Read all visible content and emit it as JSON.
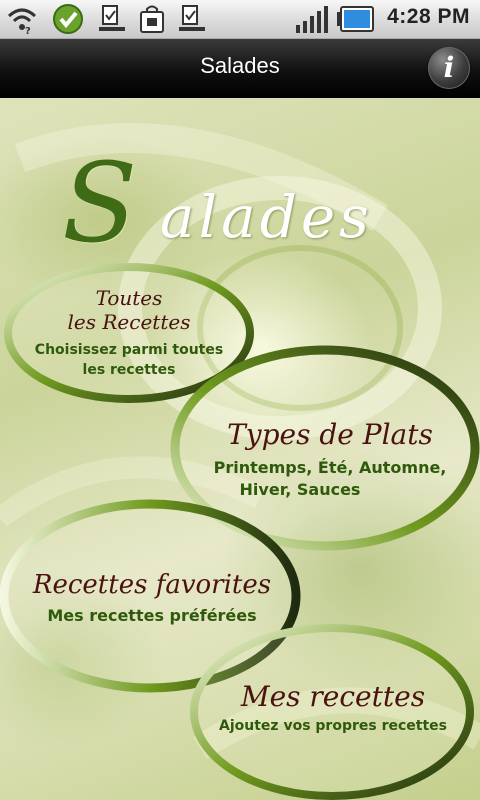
{
  "status_bar": {
    "icons": [
      "wifi-icon",
      "check-circle-icon",
      "download-done-icon",
      "shopping-bag-icon",
      "download-done-icon",
      "signal-bars-icon",
      "battery-icon"
    ],
    "time": "4:28 PM"
  },
  "title_bar": {
    "title": "Salades",
    "info_label": "i"
  },
  "hero": {
    "first_letter": "S",
    "rest": "alades"
  },
  "menu": [
    {
      "title_line1": "Toutes",
      "title_line2": "les Recettes",
      "subtitle_line1": "Choisissez parmi toutes",
      "subtitle_line2": "les recettes"
    },
    {
      "title_line1": "Types de Plats",
      "subtitle_line1": "Printemps, Été, Automne,",
      "subtitle_line2": "Hiver, Sauces"
    },
    {
      "title_line1": "Recettes favorites",
      "subtitle_line1": "Mes recettes préférées"
    },
    {
      "title_line1": "Mes recettes",
      "subtitle_line1": "Ajoutez vos propres recettes"
    }
  ],
  "colors": {
    "title_text": "#4a1212",
    "subtitle_text": "#2f5a0c",
    "ring_dark": "#1f2a10",
    "ring_green": "#6f9a1e",
    "ring_light": "#f4f7e0"
  }
}
